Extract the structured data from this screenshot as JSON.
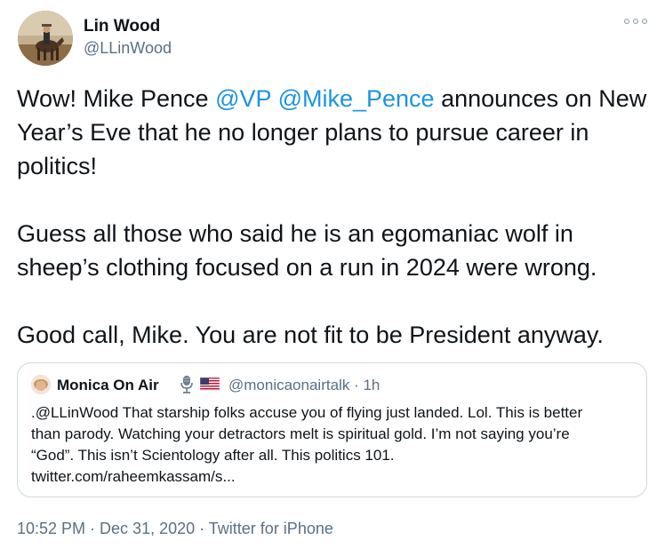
{
  "author": {
    "name": "Lin Wood",
    "handle": "@LLinWood"
  },
  "tweet": {
    "para1": {
      "before": "Wow! Mike Pence ",
      "mention1": "@VP",
      "space": " ",
      "mention2": "@Mike_Pence",
      "after": " announces on New Year’s Eve that he no longer plans to pursue career in politics!"
    },
    "para2": "Guess all those who said he is an egomaniac wolf in sheep’s clothing focused on a run in 2024 were wrong.",
    "para3": "Good call, Mike. You are not fit to be President anyway."
  },
  "quote": {
    "name": "Monica On Air",
    "handle": "@monicaonairtalk",
    "separator": " · ",
    "time": "1h",
    "lines": [
      ".@LLinWood That starship folks accuse you of flying just landed. Lol. This is better",
      "than parody. Watching your detractors melt is spiritual gold. I’m not saying you’re",
      "“God”. This isn’t Scientology after all. This politics 101.",
      "twitter.com/raheemkassam/s..."
    ]
  },
  "meta": {
    "time": "10:52 PM",
    "sep1": " · ",
    "date": "Dec 31, 2020",
    "sep2": " · ",
    "source": "Twitter for iPhone"
  },
  "icons": {
    "more": "more-options-icon",
    "mic": "microphone-icon",
    "flag": "us-flag-icon"
  },
  "colors": {
    "link": "#1b95e0",
    "secondary": "#5b7083",
    "border": "#cfd9de"
  }
}
